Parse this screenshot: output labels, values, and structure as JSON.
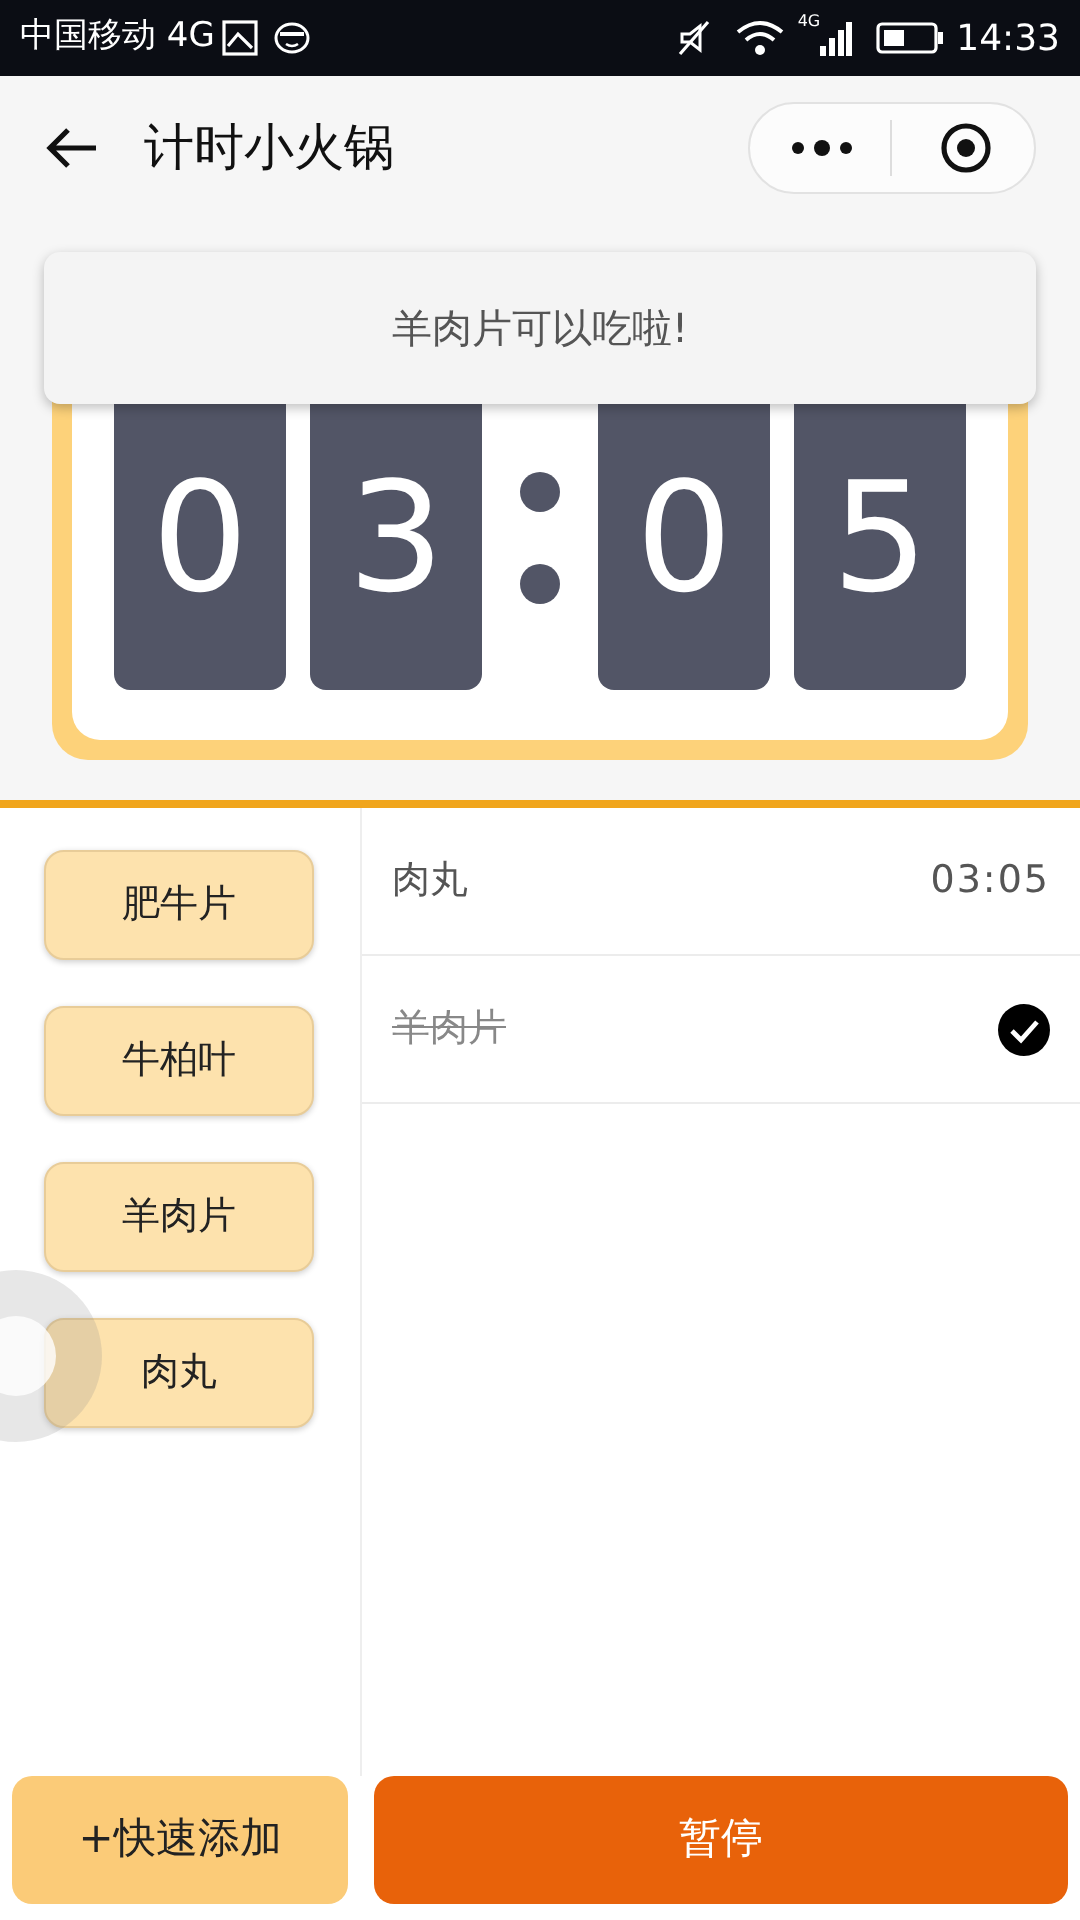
{
  "status_bar": {
    "carrier": "中国移动 4G",
    "network": "4G",
    "time": "14:33"
  },
  "nav": {
    "title": "计时小火锅"
  },
  "toast": {
    "text": "羊肉片可以吃啦!"
  },
  "timer": {
    "digits": [
      "0",
      "3",
      "0",
      "5"
    ]
  },
  "foods": [
    {
      "label": "肥牛片"
    },
    {
      "label": "牛柏叶"
    },
    {
      "label": "羊肉片"
    },
    {
      "label": "肉丸"
    }
  ],
  "records": [
    {
      "name": "肉丸",
      "time": "03:05",
      "done": false
    },
    {
      "name": "羊肉片",
      "done": true
    }
  ],
  "buttons": {
    "add": "+快速添加",
    "pause": "暂停"
  }
}
